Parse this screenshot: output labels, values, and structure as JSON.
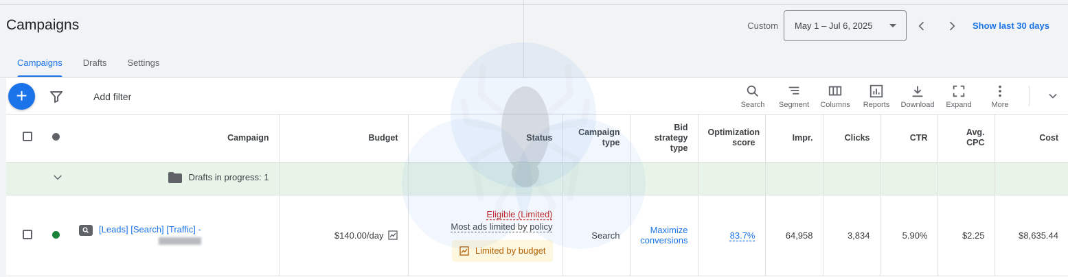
{
  "header": {
    "title": "Campaigns",
    "date_label": "Custom",
    "date_range": "May 1 – Jul 6, 2025",
    "show_last": "Show last 30 days"
  },
  "tabs": [
    {
      "label": "Campaigns",
      "active": true
    },
    {
      "label": "Drafts",
      "active": false
    },
    {
      "label": "Settings",
      "active": false
    }
  ],
  "toolbar": {
    "add_label": "+",
    "add_filter": "Add filter",
    "tools": {
      "search": "Search",
      "segment": "Segment",
      "columns": "Columns",
      "reports": "Reports",
      "download": "Download",
      "expand": "Expand",
      "more": "More"
    }
  },
  "table": {
    "headers": {
      "campaign": "Campaign",
      "budget": "Budget",
      "status": "Status",
      "campaign_type": "Campaign type",
      "bid_strategy": "Bid strategy type",
      "optimization": "Optimization score",
      "impr": "Impr.",
      "clicks": "Clicks",
      "ctr": "CTR",
      "avg_cpc": "Avg. CPC",
      "cost": "Cost"
    },
    "drafts_row": {
      "label": "Drafts in progress: 1"
    },
    "rows": [
      {
        "status_color": "#188038",
        "name": "[Leads] [Search] [Traffic] -",
        "budget": "$140.00/day",
        "status_main": "Eligible (Limited)",
        "status_sub": "Most ads limited by policy",
        "status_chip": "Limited by budget",
        "campaign_type": "Search",
        "bid_strategy": "Maximize conversions",
        "optimization": "83.7%",
        "impr": "64,958",
        "clicks": "3,834",
        "ctr": "5.90%",
        "avg_cpc": "$2.25",
        "cost": "$8,635.44"
      }
    ]
  },
  "colors": {
    "accent": "#1a73e8",
    "drafts_bg": "#e8f4e8",
    "warning": "#c5221f",
    "chip_text": "#b06000"
  }
}
